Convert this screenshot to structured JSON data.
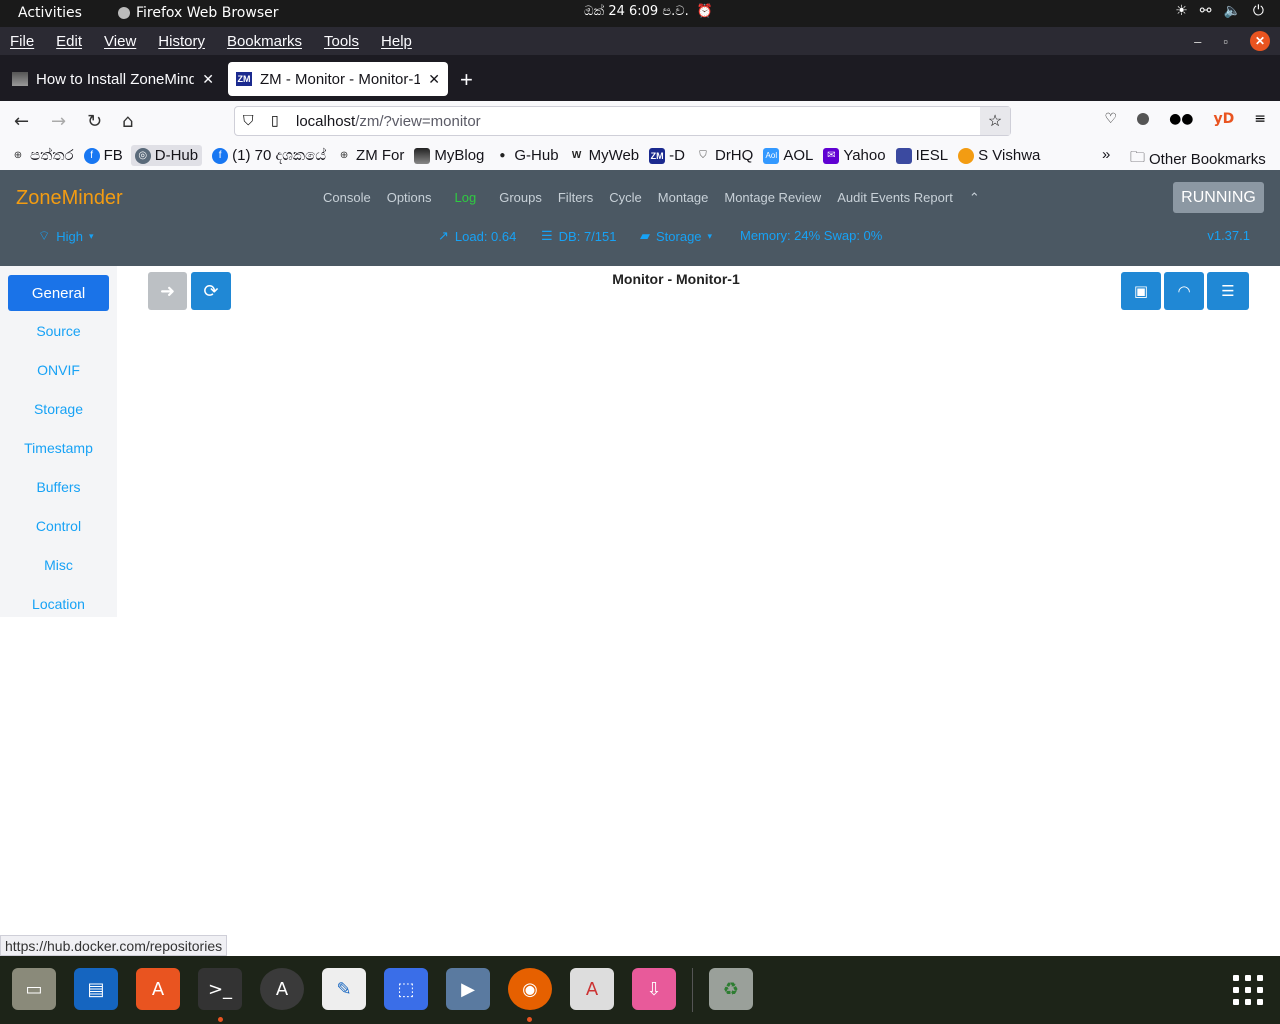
{
  "system": {
    "activities": "Activities",
    "app_name": "Firefox Web Browser",
    "clock": "ඔක් 24  6:09 ප.ව."
  },
  "menubar": [
    "File",
    "Edit",
    "View",
    "History",
    "Bookmarks",
    "Tools",
    "Help"
  ],
  "tabs": [
    {
      "title": "How to Install ZoneMinde",
      "active": false
    },
    {
      "title": "ZM - Monitor - Monitor-1",
      "active": true
    }
  ],
  "url": {
    "host": "localhost",
    "path": "/zm/?view=monitor"
  },
  "navbar_right": {
    "profile": "yD"
  },
  "bookmarks": [
    {
      "label": "පත්තර",
      "icon": "globe-icon"
    },
    {
      "label": "FB",
      "icon": "facebook-icon"
    },
    {
      "label": "D-Hub",
      "icon": "docker-icon"
    },
    {
      "label": "(1) 70 දශකයේ",
      "icon": "facebook-icon"
    },
    {
      "label": "ZM For",
      "icon": "globe-icon"
    },
    {
      "label": "MyBlog",
      "icon": "blog-icon"
    },
    {
      "label": "G-Hub",
      "icon": "github-icon"
    },
    {
      "label": "MyWeb",
      "icon": "wix-icon"
    },
    {
      "label": "-D",
      "icon": "zm-icon"
    },
    {
      "label": "DrHQ",
      "icon": "shield-icon"
    },
    {
      "label": "AOL",
      "icon": "aol-icon"
    },
    {
      "label": "Yahoo",
      "icon": "mail-icon"
    },
    {
      "label": "IESL",
      "icon": "iesl-icon"
    },
    {
      "label": "S Vishwa",
      "icon": "sv-icon"
    }
  ],
  "other_bookmarks": "Other Bookmarks",
  "zm": {
    "brand": "ZoneMinder",
    "nav": [
      "Console",
      "Options",
      "Log",
      "Groups",
      "Filters",
      "Cycle",
      "Montage",
      "Montage Review",
      "Audit Events Report"
    ],
    "status": "RUNNING",
    "bandwidth": "High",
    "load": "Load: 0.64",
    "db": "DB: 7/151",
    "storage": "Storage",
    "memory": "Memory: 24% Swap: 0%",
    "version": "v1.37.1"
  },
  "sidebar": [
    "General",
    "Source",
    "ONVIF",
    "Storage",
    "Timestamp",
    "Buffers",
    "Control",
    "Misc",
    "Location"
  ],
  "page_title": "Monitor - Monitor-1",
  "status_link": "https://hub.docker.com/repositories",
  "colors": {
    "accent": "#2088d5",
    "brand": "#f39c12",
    "header_bg": "#4b5863",
    "log_green": "#2ecc40"
  }
}
